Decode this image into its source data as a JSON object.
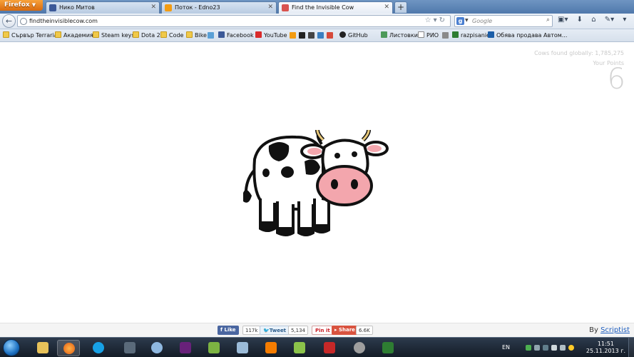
{
  "browser": {
    "menu_button": "Firefox",
    "tabs": [
      {
        "label": "Нико Митов",
        "favicon_color": "#3b5998"
      },
      {
        "label": "Поток - Edno23",
        "favicon_color": "#f39c12"
      },
      {
        "label": "Find the Invisible Cow",
        "favicon_color": "#d9534f"
      }
    ],
    "new_tab": "+",
    "url": "findtheinvisiblecow.com",
    "search_placeholder": "Google"
  },
  "bookmarks": [
    {
      "label": "Сървър Terraria",
      "icon": "folder-icon"
    },
    {
      "label": "Академия",
      "icon": "folder-icon"
    },
    {
      "label": "Steam keys",
      "icon": "folder-icon"
    },
    {
      "label": "Dota 2",
      "icon": "folder-icon"
    },
    {
      "label": "Code",
      "icon": "folder-icon"
    },
    {
      "label": "Bike",
      "icon": "folder-icon"
    },
    {
      "label": "Facebook",
      "icon": "facebook-icon"
    },
    {
      "label": "YouTube",
      "icon": "youtube-icon"
    },
    {
      "label": "GitHub",
      "icon": "github-icon"
    },
    {
      "label": "Листовки",
      "icon": "image-icon"
    },
    {
      "label": "РИО",
      "icon": "page-icon"
    },
    {
      "label": "razpisanie",
      "icon": "grid-icon"
    },
    {
      "label": "Обява продава Автом...",
      "icon": "site-icon"
    }
  ],
  "page": {
    "cows_found": "Cows found globally: 1,785,275",
    "your_points_label": "Your Points",
    "your_points_value": "6"
  },
  "footer": {
    "like_label": "Like",
    "like_count": "117k",
    "tweet_label": "Tweet",
    "tweet_count": "5,134",
    "pin_label": "Pin it",
    "share_label": "Share",
    "share_count": "6.6K",
    "by_prefix": "By",
    "by_link": "Scriptist"
  },
  "taskbar": {
    "language": "EN",
    "time": "11:51",
    "date": "25.11.2013 г."
  }
}
